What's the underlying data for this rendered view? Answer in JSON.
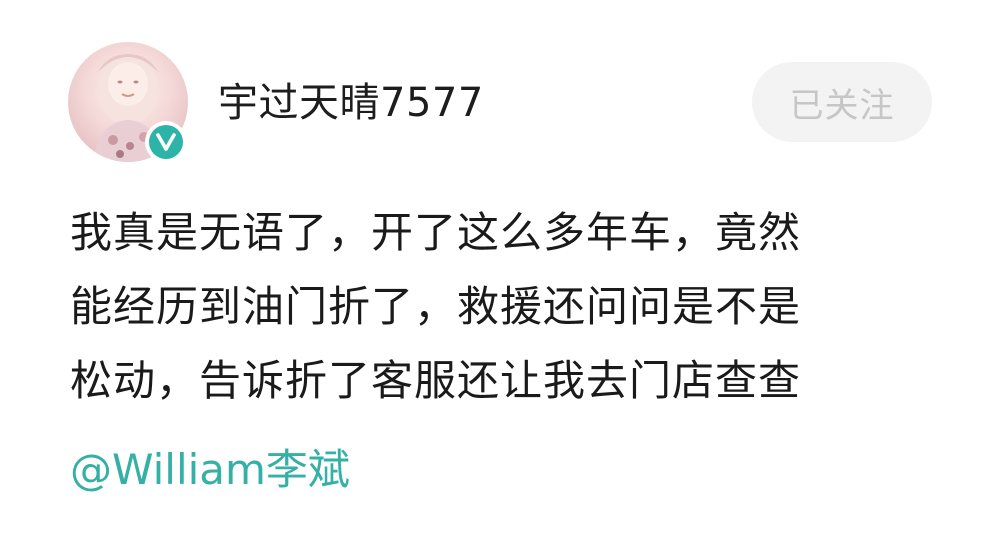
{
  "user": {
    "name": "宇过天晴7577",
    "verified_badge_letter": "V",
    "avatar_icon": "avatar-photo"
  },
  "follow_button": {
    "label": "已关注"
  },
  "post": {
    "lines": [
      "我真是无语了，开了这么多年车，竟然",
      "能经历到油门折了，救援还问问是不是",
      "松动，告诉折了客服还让我去门店查查"
    ],
    "mention": "@William李斌"
  },
  "colors": {
    "accent_teal": "#35b0a6",
    "text_primary": "#1a1a1a",
    "follow_bg": "#f3f3f3",
    "follow_text": "#c6c6c6"
  }
}
